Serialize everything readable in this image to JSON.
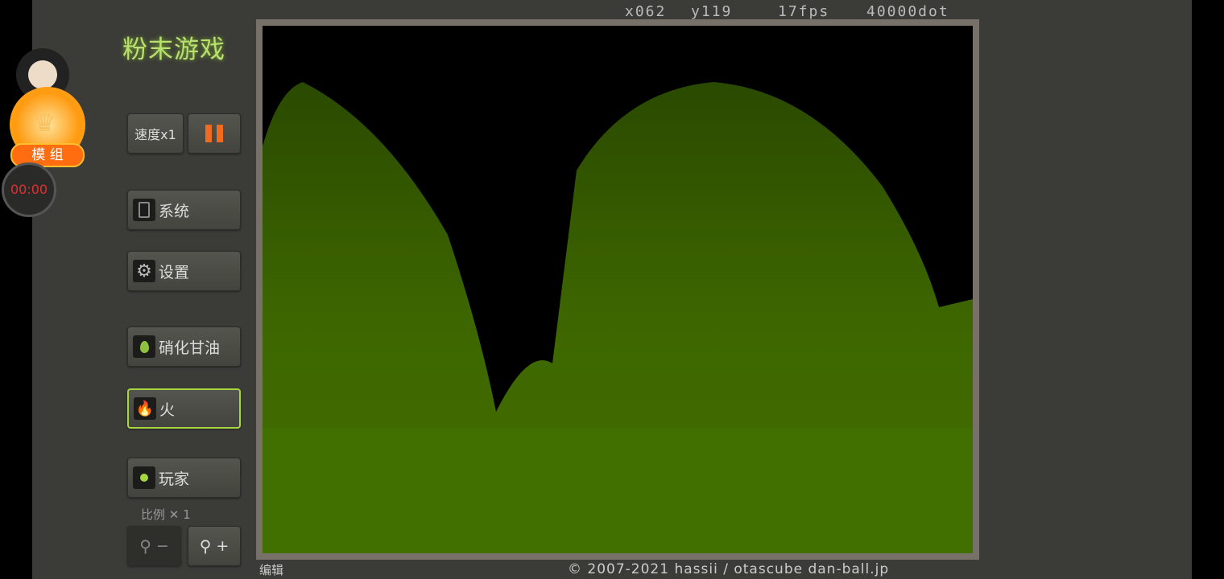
{
  "title": "粉末游戏",
  "overlay": {
    "badge_label": "模 组",
    "timer": "00:00"
  },
  "hud": {
    "x": "x062",
    "y": "y119",
    "fps": "17fps",
    "dots": "40000dot"
  },
  "buttons": {
    "speed": "速度x1",
    "system": "系统",
    "settings": "设置",
    "element1": "硝化甘油",
    "element2": "火",
    "element3": "玩家"
  },
  "scale_label": "比例 ✕ 1",
  "zoom_out": "−",
  "zoom_in": "+",
  "footer": {
    "edit": "编辑",
    "copyright": "© 2007-2021 hassii / otascube  dan-ball.jp"
  },
  "colors": {
    "accent": "#a6d640",
    "pause": "#f06a20",
    "powder": "#3f6a00"
  }
}
